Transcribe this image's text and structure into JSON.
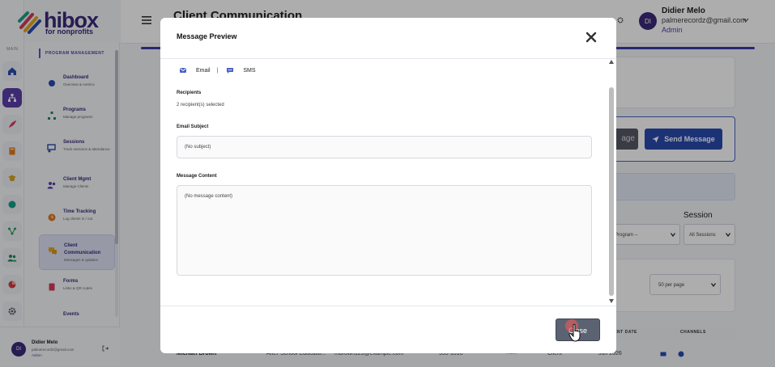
{
  "app": {
    "logo_word": "hibox",
    "logo_sub": "for nonprofits"
  },
  "rail": {
    "section_label": "MAIN",
    "items": [
      {
        "icon": "home-icon"
      },
      {
        "icon": "org-chart-icon",
        "active": true
      },
      {
        "icon": "feather-icon"
      },
      {
        "icon": "book-icon"
      },
      {
        "icon": "graduation-cap-icon"
      },
      {
        "icon": "globe-icon"
      },
      {
        "icon": "network-icon"
      },
      {
        "icon": "users-icon"
      },
      {
        "icon": "pie-chart-icon"
      },
      {
        "icon": "gear-icon"
      }
    ]
  },
  "sidebar": {
    "section_title": "PROGRAM MANAGEMENT",
    "items": [
      {
        "title": "Dashboard",
        "subtitle": "Overview & metrics",
        "icon": "dashboard-icon"
      },
      {
        "title": "Programs",
        "subtitle": "Manage programs",
        "icon": "programs-icon"
      },
      {
        "title": "Sessions",
        "subtitle": "Track sessions & attendance",
        "icon": "sessions-icon"
      },
      {
        "title": "Client Mgmt",
        "subtitle": "Manage Clients",
        "icon": "clients-icon"
      },
      {
        "title": "Time Tracking",
        "subtitle": "Log clients in / out",
        "icon": "clock-icon"
      },
      {
        "title": "Client Communication",
        "subtitle": "Messages & updates",
        "icon": "chat-icon",
        "active": true
      },
      {
        "title": "Forms",
        "subtitle": "Links & QR codes",
        "icon": "forms-icon"
      },
      {
        "title": "Events",
        "subtitle": "",
        "icon": ""
      }
    ]
  },
  "user": {
    "initials": "DI",
    "name": "Didier Melo",
    "email": "palmerecordz@gmail.com",
    "role": "Admin"
  },
  "header": {
    "page_title": "Client Communication"
  },
  "background": {
    "dark_button_label": "age",
    "send_button_label": "Send Message",
    "session_label": "Session",
    "program_select": "Program --",
    "session_select": "All Sessions",
    "per_page_select": "50 per page",
    "table_headers": [
      "LMENT DATE",
      "CHANNELS"
    ],
    "row": {
      "name": "Michael Brown",
      "program": "After-School Educatio...",
      "email": "mbrown123@example.com",
      "phone": "555-1010",
      "status": "Active",
      "type": "Client",
      "date": "Jun 2026"
    }
  },
  "modal": {
    "title": "Message Preview",
    "channels": {
      "email_label": "Email",
      "separator": "|",
      "sms_label": "SMS"
    },
    "recipients_label": "Recipients",
    "recipients_value": "2 recipient(s) selected",
    "subject_label": "Email Subject",
    "subject_value": "(No subject)",
    "content_label": "Message Content",
    "content_value": "(No message content)",
    "close_label": "Close"
  },
  "colors": {
    "brand": "#3b2a7a",
    "accent": "#2a4bb0",
    "close_button": "#5b6373"
  }
}
